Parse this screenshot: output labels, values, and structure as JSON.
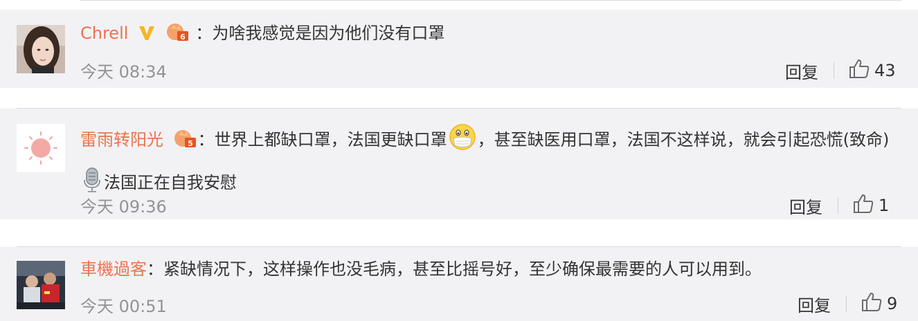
{
  "comments": [
    {
      "username": "Chrell",
      "colon": "：",
      "text": "为啥我感觉是因为他们没有口罩",
      "time": "今天 08:34",
      "reply_label": "回复",
      "likes": "43",
      "badges": [
        "vip-v-badge",
        "level-6-badge"
      ]
    },
    {
      "username": "雷雨转阳光",
      "colon": "：",
      "text_part1": "世界上都缺口罩，法国更缺口罩",
      "text_part2": "，甚至缺医用口罩，法国不这样说，就会引起恐慌(致命)",
      "text_part3": "法国正在自我安慰",
      "time": "今天 09:36",
      "reply_label": "回复",
      "likes": "1",
      "badges": [
        "level-5-badge"
      ],
      "emojis": [
        "mask-face-emoji",
        "microphone-emoji"
      ]
    },
    {
      "username": "車機過客",
      "colon": "：",
      "text": "紧缺情况下，这样操作也没毛病，甚至比摇号好，至少确保最需要的人可以用到。",
      "time": "今天 00:51",
      "reply_label": "回复",
      "likes": "9",
      "badges": []
    }
  ],
  "colors": {
    "username": "#eb7350",
    "text": "#333333",
    "time": "#939393",
    "card_bg": "#f2f2f5",
    "vip_gold": "#f7b521"
  }
}
